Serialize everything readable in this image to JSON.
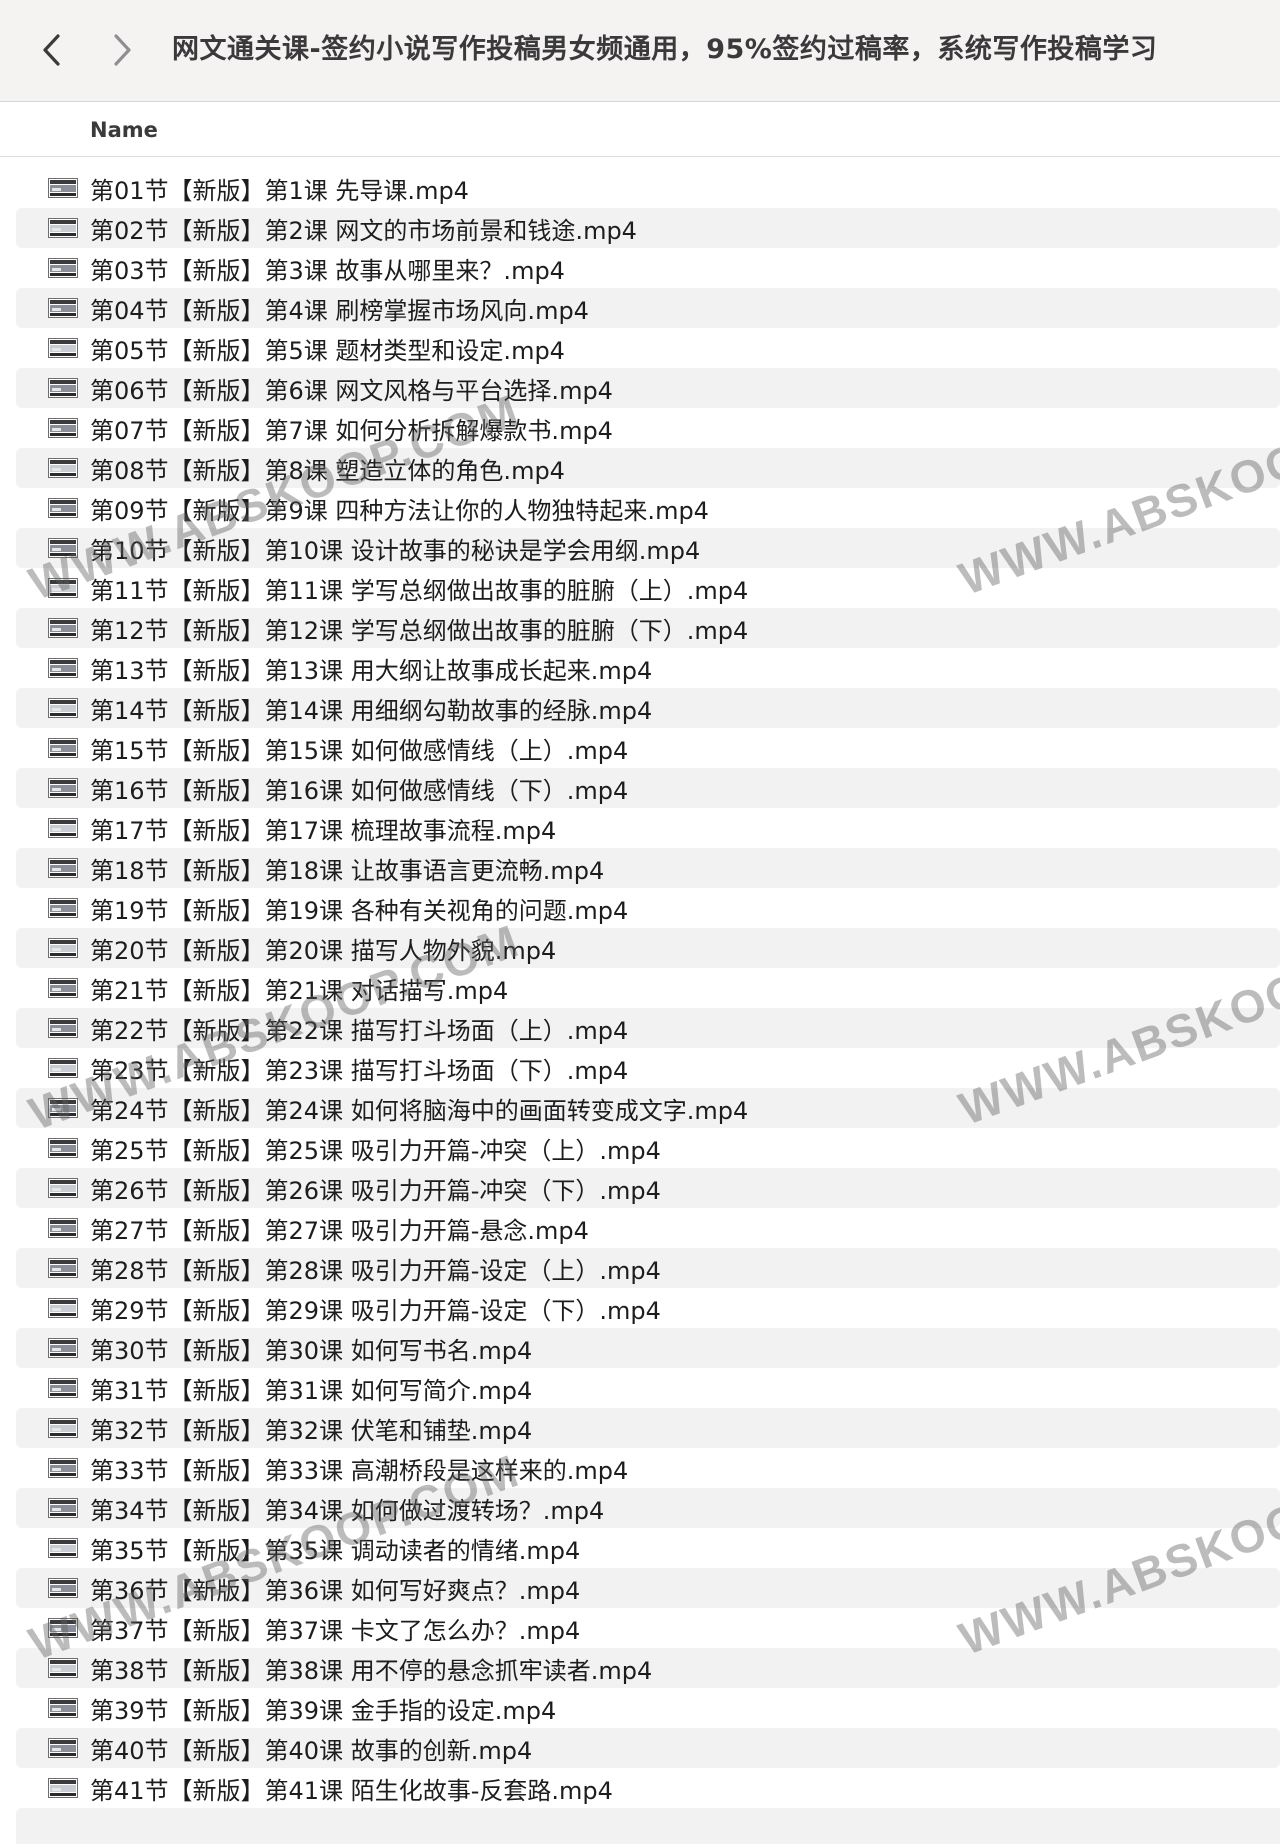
{
  "window": {
    "title": "网文通关课-签约小说写作投稿男女频通用，95%签约过稿率，系统写作投稿学习"
  },
  "toolbar": {
    "back_icon": "chevron-left-icon",
    "forward_icon": "chevron-right-icon"
  },
  "list": {
    "column_name": "Name",
    "items": [
      "第01节【新版】第1课 先导课.mp4",
      "第02节【新版】第2课 网文的市场前景和钱途.mp4",
      "第03节【新版】第3课 故事从哪里来？.mp4",
      "第04节【新版】第4课 刷榜掌握市场风向.mp4",
      "第05节【新版】第5课 题材类型和设定.mp4",
      "第06节【新版】第6课 网文风格与平台选择.mp4",
      "第07节【新版】第7课 如何分析拆解爆款书.mp4",
      "第08节【新版】第8课 塑造立体的角色.mp4",
      "第09节【新版】第9课 四种方法让你的人物独特起来.mp4",
      "第10节【新版】第10课 设计故事的秘诀是学会用纲.mp4",
      "第11节【新版】第11课 学写总纲做出故事的脏腑（上）.mp4",
      "第12节【新版】第12课 学写总纲做出故事的脏腑（下）.mp4",
      "第13节【新版】第13课 用大纲让故事成长起来.mp4",
      "第14节【新版】第14课 用细纲勾勒故事的经脉.mp4",
      "第15节【新版】第15课 如何做感情线（上）.mp4",
      "第16节【新版】第16课 如何做感情线（下）.mp4",
      "第17节【新版】第17课  梳理故事流程.mp4",
      "第18节【新版】第18课 让故事语言更流畅.mp4",
      "第19节【新版】第19课  各种有关视角的问题.mp4",
      "第20节【新版】第20课 描写人物外貌.mp4",
      "第21节【新版】第21课 对话描写.mp4",
      "第22节【新版】第22课 描写打斗场面（上）.mp4",
      "第23节【新版】第23课 描写打斗场面（下）.mp4",
      "第24节【新版】第24课 如何将脑海中的画面转变成文字.mp4",
      "第25节【新版】第25课  吸引力开篇-冲突（上）.mp4",
      "第26节【新版】第26课 吸引力开篇-冲突（下）.mp4",
      "第27节【新版】第27课 吸引力开篇-悬念.mp4",
      "第28节【新版】第28课 吸引力开篇-设定（上）.mp4",
      "第29节【新版】第29课 吸引力开篇-设定（下）.mp4",
      "第30节【新版】第30课 如何写书名.mp4",
      "第31节【新版】第31课 如何写简介.mp4",
      "第32节【新版】第32课 伏笔和铺垫.mp4",
      "第33节【新版】第33课 高潮桥段是这样来的.mp4",
      "第34节【新版】第34课 如何做过渡转场？.mp4",
      "第35节【新版】第35课 调动读者的情绪.mp4",
      "第36节【新版】第36课 如何写好爽点？.mp4",
      "第37节【新版】第37课 卡文了怎么办？.mp4",
      "第38节【新版】第38课 用不停的悬念抓牢读者.mp4",
      "第39节【新版】第39课 金手指的设定.mp4",
      "第40节【新版】第40课 故事的创新.mp4",
      "第41节【新版】第41课 陌生化故事-反套路.mp4"
    ]
  },
  "watermark": {
    "text": "WWW.ABSKOOP.COM"
  },
  "colors": {
    "toolbar_bg": "#f5f3f2",
    "row_alt": "#f2f2f2",
    "text": "#1d1d1f"
  }
}
